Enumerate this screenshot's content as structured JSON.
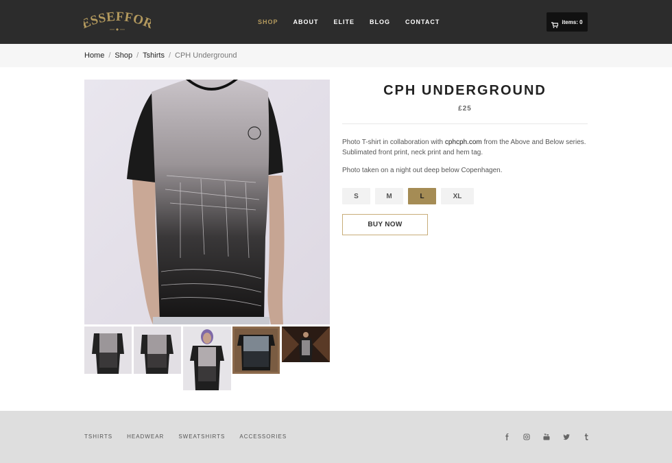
{
  "header": {
    "logo_text": "LESSEFFORT",
    "nav": [
      {
        "label": "SHOP",
        "active": true
      },
      {
        "label": "ABOUT",
        "active": false
      },
      {
        "label": "ELITE",
        "active": false
      },
      {
        "label": "BLOG",
        "active": false
      },
      {
        "label": "CONTACT",
        "active": false
      }
    ],
    "cart_label": "items: 0",
    "cart_icon": "shopping-cart-icon"
  },
  "breadcrumb": {
    "items": [
      "Home",
      "Shop",
      "Tshirts"
    ],
    "current": "CPH Underground",
    "separator": "/"
  },
  "product": {
    "title": "CPH UNDERGROUND",
    "price": "£25",
    "desc_part1": "Photo T-shirt in collaboration with ",
    "desc_link": "cphcph.com",
    "desc_part2": " from the Above and Below series. Sublimated front print, neck print and hem tag.",
    "desc2": "Photo taken on a night out deep below Copenhagen.",
    "sizes": [
      "S",
      "M",
      "L",
      "XL"
    ],
    "selected_size": "L",
    "buy_label": "BUY NOW"
  },
  "footer": {
    "links": [
      "TSHIRTS",
      "HEADWEAR",
      "SWEATSHIRTS",
      "ACCESSORIES"
    ],
    "socials": [
      "facebook-icon",
      "instagram-icon",
      "youtube-icon",
      "twitter-icon",
      "tumblr-icon"
    ]
  },
  "colors": {
    "accent": "#b49a5e",
    "header_bg": "#2c2c2c",
    "selected_size_bg": "#a58c55",
    "footer_bg": "#dedede"
  }
}
